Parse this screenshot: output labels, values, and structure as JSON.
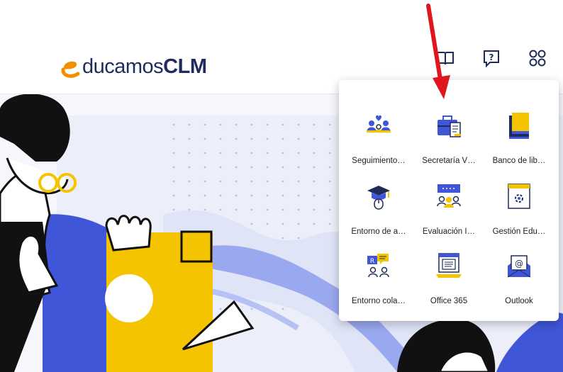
{
  "header": {
    "logo": {
      "e": "e",
      "ducamos": "ducamos",
      "clm": "CLM"
    },
    "icons": [
      "book-icon",
      "help-icon",
      "apps-grid-icon"
    ]
  },
  "apps_panel": {
    "apps": [
      {
        "label": "Seguimiento…",
        "icon": "people-heart-icon"
      },
      {
        "label": "Secretaría V…",
        "icon": "briefcase-document-icon"
      },
      {
        "label": "Banco de lib…",
        "icon": "books-icon"
      },
      {
        "label": "Entorno de a…",
        "icon": "graduation-mouse-icon"
      },
      {
        "label": "Evaluación I…",
        "icon": "evaluation-group-icon"
      },
      {
        "label": "Gestión Edu…",
        "icon": "gear-window-icon"
      },
      {
        "label": "Entorno cola…",
        "icon": "collaboration-chat-icon"
      },
      {
        "label": "Office 365",
        "icon": "laptop-document-icon"
      },
      {
        "label": "Outlook",
        "icon": "email-envelope-icon"
      }
    ]
  },
  "colors": {
    "navy": "#1f2b5b",
    "accent_blue": "#3f56d8",
    "yellow": "#f5c400",
    "orange": "#f29100",
    "arrow_red": "#e0161e"
  }
}
